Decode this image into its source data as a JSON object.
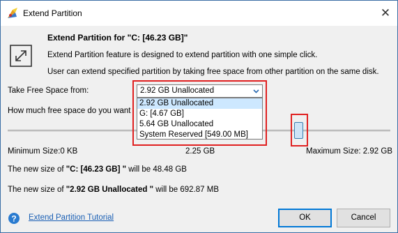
{
  "window": {
    "title": "Extend Partition"
  },
  "header": {
    "heading": "Extend Partition for \"C: [46.23 GB]\"",
    "description_1": "Extend Partition feature is designed to extend partition with one simple click.",
    "description_2": "User can extend specified partition by taking free space from other partition on the same disk."
  },
  "take_free_space": {
    "label": "Take Free Space from:",
    "selected": "2.92 GB Unallocated",
    "options": [
      "2.92 GB Unallocated",
      "G:  [4.67 GB]",
      "5.64 GB Unallocated",
      "System Reserved [549.00 MB]"
    ]
  },
  "how_much": {
    "label": "How much free space do you want"
  },
  "slider": {
    "min_label": "Minimum Size:0 KB",
    "mid_label": "2.25 GB",
    "max_label": "Maximum Size: 2.92 GB"
  },
  "result": {
    "c_prefix": "The new size of ",
    "c_name": "\"C: [46.23 GB] \"",
    "c_suffix": " will be 48.48 GB",
    "u_prefix": "The new size of ",
    "u_name": "\"2.92 GB Unallocated \"",
    "u_suffix": " will be 692.87 MB"
  },
  "footer": {
    "tutorial_link": "Extend Partition Tutorial",
    "ok_label": "OK",
    "cancel_label": "Cancel"
  },
  "icons": {
    "app": "minitool-app-icon",
    "close": "close-icon",
    "extend": "extend-arrows-icon",
    "help": "help-question-icon",
    "dropdown": "chevron-down-icon"
  },
  "colors": {
    "accent": "#0078d7",
    "highlight_outline": "#e02020",
    "selection": "#cde8ff",
    "link": "#1a5fb4"
  }
}
